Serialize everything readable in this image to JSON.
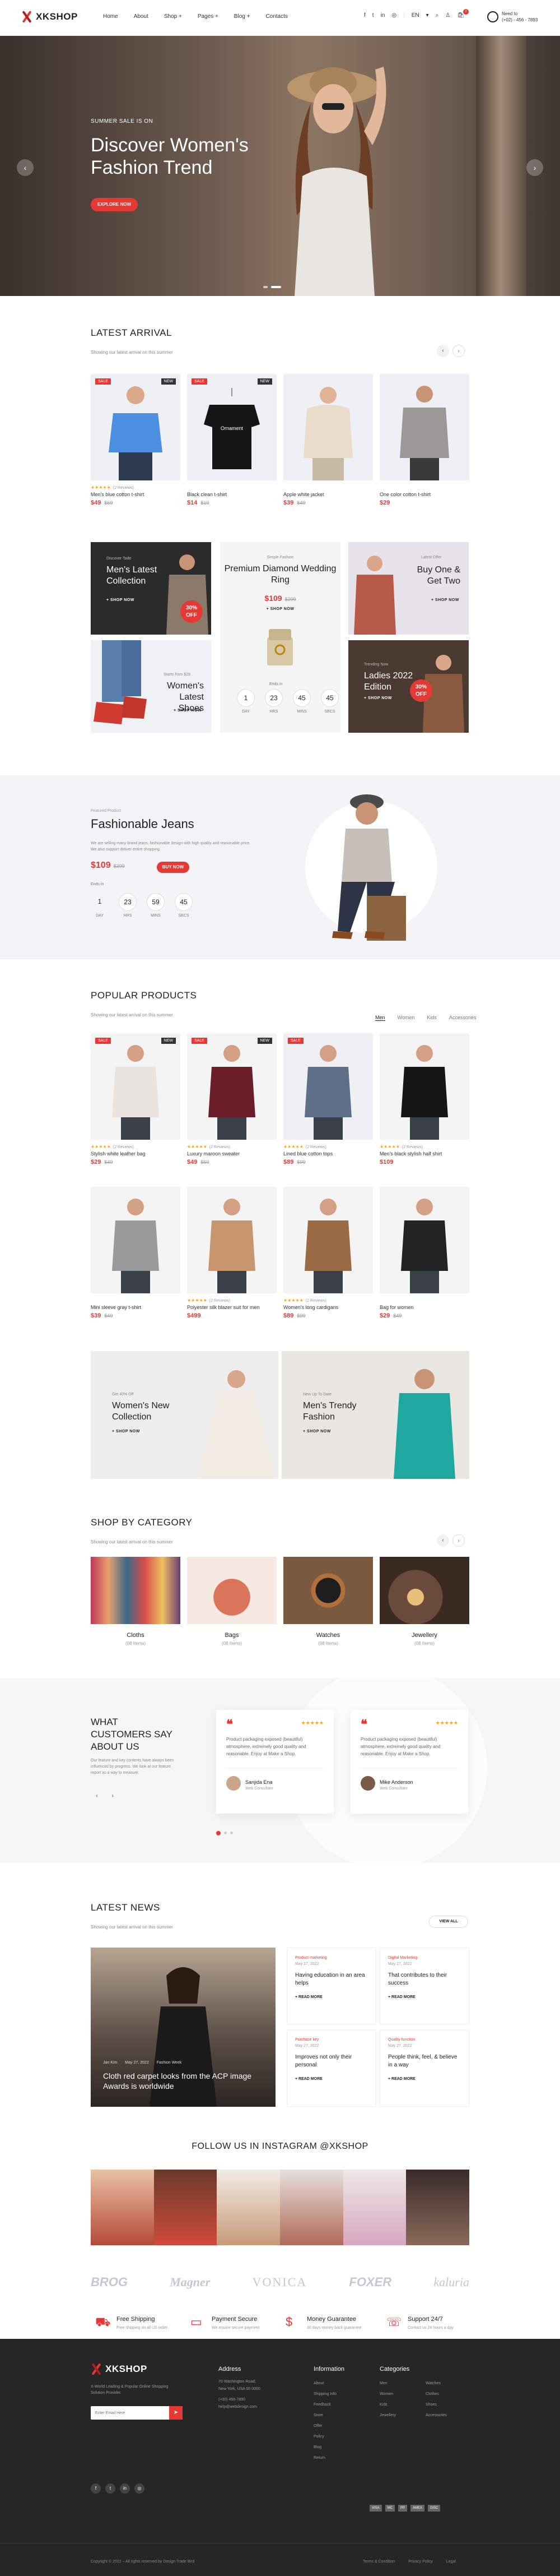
{
  "header": {
    "brand": "XKSHOP",
    "nav": [
      "Home",
      "About",
      "Shop +",
      "Pages +",
      "Blog +",
      "Contacts"
    ],
    "lang": "EN",
    "cart_count": "2",
    "help_label": "Need to",
    "help_phone": "(+02) - 456 - 7893"
  },
  "hero": {
    "kicker": "SUMMER SALE IS ON",
    "title": "Discover Women's Fashion Trend",
    "button": "EXPLORE NOW",
    "bg": "#6a584e"
  },
  "latest": {
    "title": "LATEST ARRIVAL",
    "subtitle": "Showing our latest arrival on this summer",
    "items": [
      {
        "tag": "SALE",
        "tag2": "NEW",
        "stars": "★★★★★",
        "reviews": "(2 Reviews)",
        "name": "Men's blue cotton t-shirt",
        "price": "$49",
        "old": "$69"
      },
      {
        "tag": "SALE",
        "tag2": "NEW",
        "stars": "",
        "reviews": "",
        "name": "Black clean t-shirt",
        "price": "$14",
        "old": "$19"
      },
      {
        "tag": "",
        "tag2": "",
        "stars": "",
        "reviews": "",
        "name": "Apple white jacket",
        "price": "$39",
        "old": "$49"
      },
      {
        "tag": "",
        "tag2": "",
        "stars": "",
        "reviews": "",
        "name": "One color cotton t-shirt",
        "price": "$29",
        "old": ""
      }
    ]
  },
  "banners": {
    "b1": {
      "small": "Discover Tade",
      "title": "Men's Latest Collection",
      "shop": "+ SHOP NOW",
      "off": "30%",
      "offl": "OFF"
    },
    "b2": {
      "small": "Simple Fashion",
      "title": "Premium Diamond Wedding Ring",
      "price": "$109",
      "old": "$399",
      "shop": "+ SHOP NOW",
      "ends": "Ends in",
      "cd": [
        [
          "1",
          "DAY"
        ],
        [
          "23",
          "HRS"
        ],
        [
          "45",
          "MINS"
        ],
        [
          "45",
          "SECS"
        ]
      ]
    },
    "b3": {
      "small": "Latest Offer",
      "title": "Buy One & Get Two",
      "shop": "+ SHOP NOW"
    },
    "b4": {
      "small": "Starts from $29",
      "title": "Women's Latest Shoes",
      "shop": "+ SHOP NOW"
    },
    "b5": {
      "small": "Trending Now",
      "title": "Ladies 2022 Edition",
      "shop": "+ SHOP NOW",
      "off": "30%",
      "offl": "OFF"
    }
  },
  "featured": {
    "kicker": "Featured Product",
    "title": "Fashionable Jeans",
    "desc": "We are selling many brand jeans, fashionable design with high quality and reasonable price. We also support deliver entire shopping.",
    "price": "$109",
    "old": "$399",
    "button": "BUY NOW",
    "ends": "Ends in",
    "cd": [
      [
        "1",
        "DAY"
      ],
      [
        "23",
        "HRS"
      ],
      [
        "59",
        "MINS"
      ],
      [
        "45",
        "SECS"
      ]
    ]
  },
  "popular": {
    "title": "POPULAR PRODUCTS",
    "subtitle": "Showing our latest arrival on this summer",
    "tabs": [
      "Men",
      "Women",
      "Kids",
      "Accessories"
    ],
    "items": [
      {
        "tag": "SALE",
        "tag2": "NEW",
        "stars": "★★★★★",
        "reviews": "(2 Reviews)",
        "name": "Stylish white leather bag",
        "price": "$29",
        "old": "$49"
      },
      {
        "tag": "SALE",
        "tag2": "NEW",
        "stars": "★★★★★",
        "reviews": "(2 Reviews)",
        "name": "Luxury maroon sweater",
        "price": "$49",
        "old": "$69"
      },
      {
        "tag": "SALE",
        "tag2": "",
        "stars": "★★★★★",
        "reviews": "(2 Reviews)",
        "name": "Lined blue cotton tops",
        "price": "$89",
        "old": "$99"
      },
      {
        "tag": "",
        "tag2": "",
        "stars": "★★★★★",
        "reviews": "(2 Reviews)",
        "name": "Men's black stylish half shirt",
        "price": "$109",
        "old": ""
      },
      {
        "tag": "",
        "tag2": "",
        "stars": "",
        "reviews": "",
        "name": "Mini sleeve gray t-shirt",
        "price": "$39",
        "old": "$49"
      },
      {
        "tag": "",
        "tag2": "",
        "stars": "★★★★★",
        "reviews": "(2 Reviews)",
        "name": "Polyester silk blazer suit for men",
        "price": "$499",
        "old": ""
      },
      {
        "tag": "",
        "tag2": "",
        "stars": "★★★★★",
        "reviews": "(2 Reviews)",
        "name": "Women's long cardigans",
        "price": "$89",
        "old": "$99"
      },
      {
        "tag": "",
        "tag2": "",
        "stars": "",
        "reviews": "",
        "name": "Bag for women",
        "price": "$29",
        "old": "$49"
      }
    ]
  },
  "duo": {
    "b1": {
      "small": "Get 40% Off",
      "title": "Women's New Collection",
      "shop": "+ SHOP NOW"
    },
    "b2": {
      "small": "New Up To Date",
      "title": "Men's Trendy Fashion",
      "shop": "+ SHOP NOW"
    }
  },
  "category": {
    "title": "SHOP BY CATEGORY",
    "subtitle": "Showing our latest arrival on this summer",
    "items": [
      {
        "name": "Cloths",
        "count": "(08 Items)"
      },
      {
        "name": "Bags",
        "count": "(08 Items)"
      },
      {
        "name": "Watches",
        "count": "(08 Items)"
      },
      {
        "name": "Jewellery",
        "count": "(08 Items)"
      }
    ]
  },
  "testimonials": {
    "title": "WHAT CUSTOMERS SAY ABOUT US",
    "desc": "Our feature and key contents have always been influenced by progress. We look at our feature report as a way to measure.",
    "items": [
      {
        "stars": "★★★★★",
        "text": "Product packaging exposed (beautiful) atmosphere, extremely good quality and reasonable. Enjoy at Make a Shop.",
        "name": "Sanjida Ena",
        "role": "Web Consultant"
      },
      {
        "stars": "★★★★★",
        "text": "Product packaging exposed (beautiful) atmosphere, extremely good quality and reasonable. Enjoy at Make a Shop.",
        "name": "Mike Anderson",
        "role": "Web Consultant"
      }
    ]
  },
  "news": {
    "title": "LATEST NEWS",
    "subtitle": "Showing our latest arrival on this summer",
    "view_all": "VIEW ALL",
    "main": {
      "author": "Jan Kim",
      "date": "May 27, 2022",
      "cat": "Fashion Week",
      "title": "Cloth red carpet looks from the ACP image Awards is worldwide"
    },
    "items": [
      {
        "cat": "Product marketing",
        "date": "May 27, 2022",
        "title": "Having education in an area helps",
        "more": "+ READ MORE"
      },
      {
        "cat": "Digital Marketing",
        "date": "May 27, 2022",
        "title": "That contributes to their success",
        "more": "+ READ MORE"
      },
      {
        "cat": "Purchase key",
        "date": "May 27, 2022",
        "title": "Improves not only their personal",
        "more": "+ READ MORE"
      },
      {
        "cat": "Quality function",
        "date": "May 27, 2022",
        "title": "People think, feel, & believe in a way",
        "more": "+ READ MORE"
      }
    ]
  },
  "instagram": {
    "title": "FOLLOW US IN INSTAGRAM @XKSHOP"
  },
  "brands": [
    "BROG",
    "Magner",
    "VONICA",
    "FOXER",
    "kaluria"
  ],
  "services": [
    {
      "title": "Free Shipping",
      "desc": "Free shipping on all US order"
    },
    {
      "title": "Payment Secure",
      "desc": "We ensure secure payment"
    },
    {
      "title": "Money Guarantee",
      "desc": "30 days money back guarantee"
    },
    {
      "title": "Support 24/7",
      "desc": "Contact us 24 hours a day"
    }
  ],
  "footer": {
    "brand": "XKSHOP",
    "about": "X-World Leading & Popular Online Shopping Solution Provider.",
    "email_ph": "Enter Email Here",
    "address_t": "Address",
    "address": [
      "70 Washington Road,",
      "New York, USA 00 0000",
      "(+00) 456-7890",
      "help@webdesign.com"
    ],
    "info_t": "Information",
    "info": [
      "About",
      "Shipping Info",
      "Feedback",
      "Store",
      "Offer",
      "Policy",
      "Blog",
      "Return"
    ],
    "cat_t": "Categories",
    "cat1": [
      "Men",
      "Women",
      "Kids",
      "Jewellery"
    ],
    "cat2": [
      "Watches",
      "Clothes",
      "Shoes",
      "Accessories"
    ],
    "copyright": "Copyright © 2022 – All rights reserved by Design Trade Bird",
    "links": [
      "Terms & Condition",
      "Privacy Policy",
      "Legal"
    ],
    "pay": [
      "VISA",
      "MC",
      "PP",
      "AMEX",
      "DISC"
    ]
  }
}
